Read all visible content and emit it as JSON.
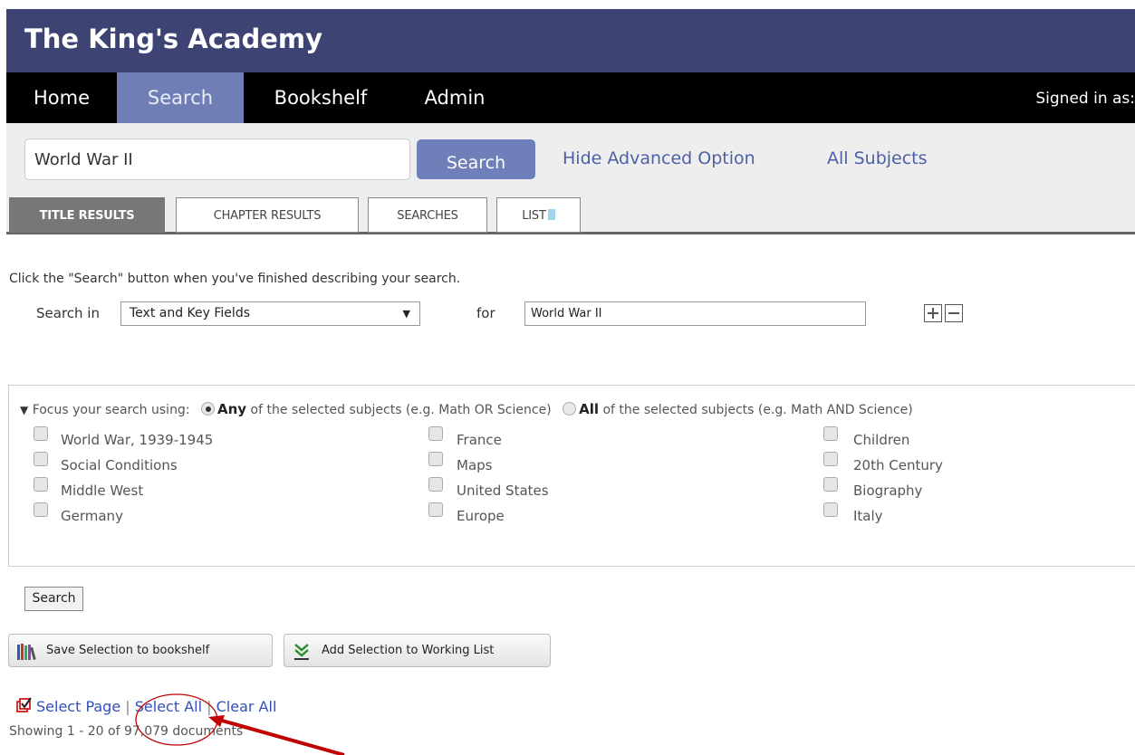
{
  "header": {
    "title": "The King's Academy"
  },
  "nav": {
    "items": [
      {
        "label": "Home"
      },
      {
        "label": "Search"
      },
      {
        "label": "Bookshelf"
      },
      {
        "label": "Admin"
      }
    ],
    "active": "Search",
    "signed_in": "Signed in as:"
  },
  "search": {
    "query": "World War II",
    "button": "Search",
    "hide_advanced": "Hide Advanced Option",
    "all_subjects": "All Subjects"
  },
  "tabs": [
    {
      "label": "TITLE RESULTS"
    },
    {
      "label": "CHAPTER RESULTS"
    },
    {
      "label": "SEARCHES"
    },
    {
      "label": "LIST"
    }
  ],
  "advanced": {
    "instruction": "Click the \"Search\" button when you've finished describing your search.",
    "search_in_label": "Search in",
    "search_in_value": "Text and Key Fields",
    "for_label": "for",
    "for_value": "World War II"
  },
  "focus": {
    "label": "Focus your search using:",
    "any_bold": "Any",
    "any_rest": "of the selected subjects (e.g. Math OR Science)",
    "all_bold": "All",
    "all_rest": "of the selected subjects (e.g. Math AND Science)",
    "selected_mode": "Any",
    "subjects": [
      [
        "World War, 1939-1945",
        "Social Conditions",
        "Middle West",
        "Germany"
      ],
      [
        "France",
        "Maps",
        "United States",
        "Europe"
      ],
      [
        "Children",
        "20th Century",
        "Biography",
        "Italy"
      ]
    ]
  },
  "actions": {
    "search_button": "Search",
    "save_bookshelf": "Save Selection to bookshelf",
    "add_working_list": "Add Selection to Working List"
  },
  "selection": {
    "select_page": "Select Page",
    "select_all": "Select All",
    "clear_all": "Clear All",
    "separator": "|",
    "showing": "Showing 1 - 20 of 97,079 documents"
  },
  "colors": {
    "header_bg": "#3d4474",
    "nav_bg": "#000000",
    "nav_active": "#6f7eb4",
    "accent_link": "#4d5fa6",
    "annotation": "#c00000"
  }
}
